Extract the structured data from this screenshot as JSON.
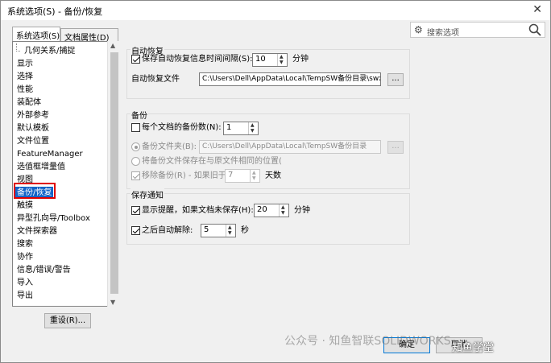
{
  "window": {
    "title": "系统选项(S) - 备份/恢复",
    "close_label": "✕"
  },
  "search": {
    "placeholder": "搜索选项"
  },
  "tabs": [
    {
      "label": "系统选项(S)",
      "active": true
    },
    {
      "label": "文档属性(D)",
      "active": false
    }
  ],
  "sidebar": {
    "items": [
      "几何关系/捕捉",
      "显示",
      "选择",
      "性能",
      "装配体",
      "外部参考",
      "默认模板",
      "文件位置",
      "FeatureManager",
      "选值框增量值",
      "视图",
      "备份/恢复",
      "触摸",
      "异型孔向导/Toolbox",
      "文件探索器",
      "搜索",
      "协作",
      "信息/错误/警告",
      "导入",
      "导出"
    ],
    "selected": "备份/恢复"
  },
  "reset_button": "重设(R)...",
  "autorecover": {
    "group_label": "自动恢复",
    "save_label": "保存自动恢复信息时间间隔(S):",
    "save_checked": true,
    "interval_value": "10",
    "interval_unit": "分钟",
    "file_label": "自动恢复文件",
    "file_path": "C:\\Users\\Dell\\AppData\\Local\\TempSW备份目录\\swxauto",
    "browse_label": "..."
  },
  "backup": {
    "group_label": "备份",
    "copies_label": "每个文档的备份数(N):",
    "copies_checked": false,
    "copies_value": "1",
    "folder_radio_label": "备份文件夹(B):",
    "folder_path": "C:\\Users\\Dell\\AppData\\Local\\TempSW备份目录",
    "browse_label": "...",
    "same_location_label": "将备份文件保存在与原文件相同的位置(",
    "remove_label": "移除备份(R) - 如果旧于",
    "remove_checked": true,
    "remove_value": "7",
    "remove_unit": "天数"
  },
  "save_notice": {
    "group_label": "保存通知",
    "prompt_label": "显示提醒，如果文档未保存(H):",
    "prompt_checked": true,
    "prompt_value": "20",
    "prompt_unit": "分钟",
    "dismiss_label": "之后自动解除:",
    "dismiss_checked": true,
    "dismiss_value": "5",
    "dismiss_unit": "秒"
  },
  "footer": {
    "ok_label": "确定",
    "cancel_label": "取消"
  },
  "watermark": {
    "text": "公众号 · 知鱼智联SOLIDWORKS",
    "overlay": "知鱼学堂"
  }
}
